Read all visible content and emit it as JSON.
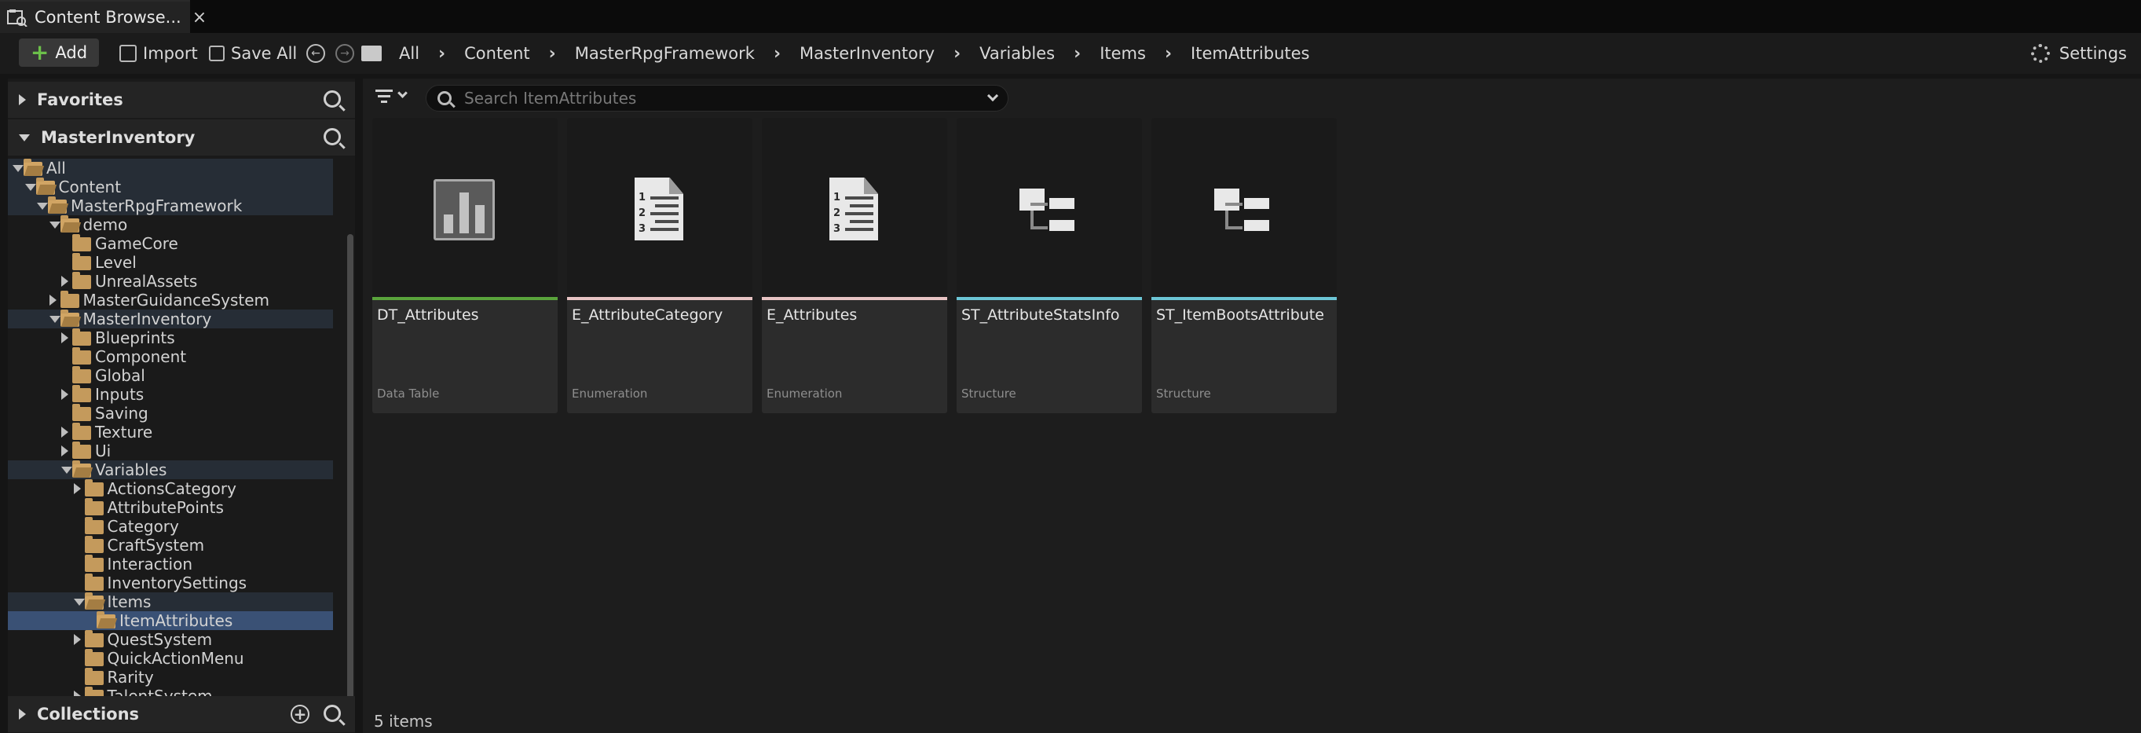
{
  "tab": {
    "title": "Content Browse...",
    "close": "×"
  },
  "toolbar": {
    "add_label": "Add",
    "import_label": "Import",
    "save_all_label": "Save All",
    "settings_label": "Settings"
  },
  "breadcrumbs": [
    "All",
    "Content",
    "MasterRpgFramework",
    "MasterInventory",
    "Variables",
    "Items",
    "ItemAttributes"
  ],
  "favorites": {
    "title": "Favorites"
  },
  "source_panel": {
    "title": "MasterInventory"
  },
  "collections": {
    "title": "Collections"
  },
  "tree": [
    {
      "label": "All",
      "depth": 0,
      "toggle": "open",
      "state": "hl"
    },
    {
      "label": "Content",
      "depth": 1,
      "toggle": "open",
      "state": "hl"
    },
    {
      "label": "MasterRpgFramework",
      "depth": 2,
      "toggle": "open",
      "state": "hl"
    },
    {
      "label": "demo",
      "depth": 3,
      "toggle": "open",
      "state": ""
    },
    {
      "label": "GameCore",
      "depth": 4,
      "toggle": "none",
      "state": ""
    },
    {
      "label": "Level",
      "depth": 4,
      "toggle": "none",
      "state": ""
    },
    {
      "label": "UnrealAssets",
      "depth": 4,
      "toggle": "closed",
      "state": ""
    },
    {
      "label": "MasterGuidanceSystem",
      "depth": 3,
      "toggle": "closed",
      "state": ""
    },
    {
      "label": "MasterInventory",
      "depth": 3,
      "toggle": "open",
      "state": "hl"
    },
    {
      "label": "Blueprints",
      "depth": 4,
      "toggle": "closed",
      "state": ""
    },
    {
      "label": "Component",
      "depth": 4,
      "toggle": "none",
      "state": ""
    },
    {
      "label": "Global",
      "depth": 4,
      "toggle": "none",
      "state": ""
    },
    {
      "label": "Inputs",
      "depth": 4,
      "toggle": "closed",
      "state": ""
    },
    {
      "label": "Saving",
      "depth": 4,
      "toggle": "none",
      "state": ""
    },
    {
      "label": "Texture",
      "depth": 4,
      "toggle": "closed",
      "state": ""
    },
    {
      "label": "Ui",
      "depth": 4,
      "toggle": "closed",
      "state": ""
    },
    {
      "label": "Variables",
      "depth": 4,
      "toggle": "open",
      "state": "hl"
    },
    {
      "label": "ActionsCategory",
      "depth": 5,
      "toggle": "closed",
      "state": ""
    },
    {
      "label": "AttributePoints",
      "depth": 5,
      "toggle": "none",
      "state": ""
    },
    {
      "label": "Category",
      "depth": 5,
      "toggle": "none",
      "state": ""
    },
    {
      "label": "CraftSystem",
      "depth": 5,
      "toggle": "none",
      "state": ""
    },
    {
      "label": "Interaction",
      "depth": 5,
      "toggle": "none",
      "state": ""
    },
    {
      "label": "InventorySettings",
      "depth": 5,
      "toggle": "none",
      "state": ""
    },
    {
      "label": "Items",
      "depth": 5,
      "toggle": "open",
      "state": "hl"
    },
    {
      "label": "ItemAttributes",
      "depth": 6,
      "toggle": "none",
      "state": "sel"
    },
    {
      "label": "QuestSystem",
      "depth": 5,
      "toggle": "closed",
      "state": ""
    },
    {
      "label": "QuickActionMenu",
      "depth": 5,
      "toggle": "none",
      "state": ""
    },
    {
      "label": "Rarity",
      "depth": 5,
      "toggle": "none",
      "state": ""
    },
    {
      "label": "TalentSystem",
      "depth": 5,
      "toggle": "closed",
      "state": ""
    }
  ],
  "search": {
    "placeholder": "Search ItemAttributes"
  },
  "assets": [
    {
      "name": "DT_Attributes",
      "type": "Data Table",
      "icon": "data-table-icon",
      "color": "#5aa43c"
    },
    {
      "name": "E_AttributeCategory",
      "type": "Enumeration",
      "icon": "enumeration-icon",
      "color": "#e8c4c4"
    },
    {
      "name": "E_Attributes",
      "type": "Enumeration",
      "icon": "enumeration-icon",
      "color": "#e8c4c4"
    },
    {
      "name": "ST_AttributeStatsInfo",
      "type": "Structure",
      "icon": "structure-icon",
      "color": "#6cc6d6"
    },
    {
      "name": "ST_ItemBootsAttribute",
      "type": "Structure",
      "icon": "structure-icon",
      "color": "#6cc6d6"
    }
  ],
  "status": {
    "item_count": "5 items"
  }
}
